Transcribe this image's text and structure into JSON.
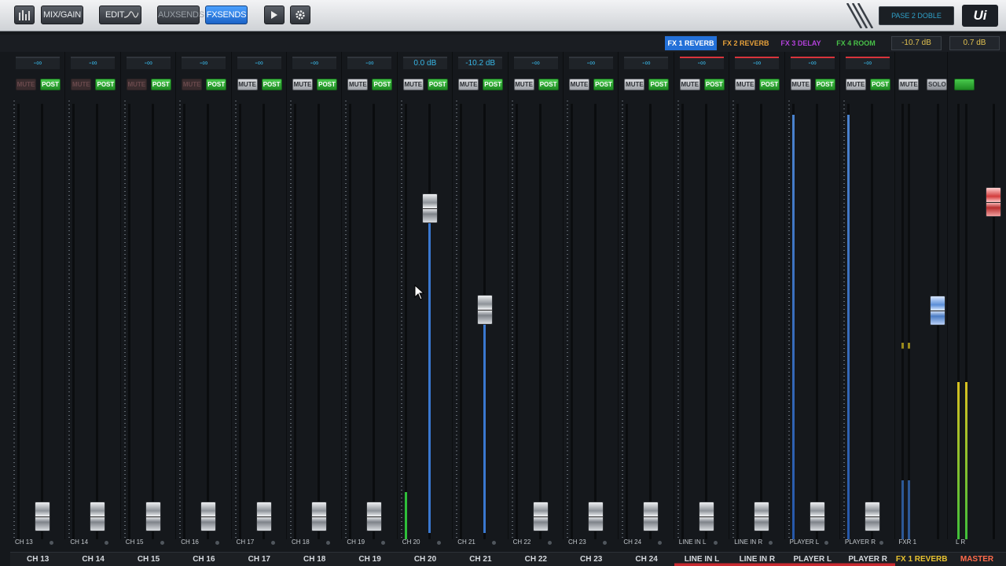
{
  "toolbar": {
    "mix_gain": "MIX/GAIN",
    "edit": "EDIT",
    "aux_sends": "AUXSENDS",
    "fx_sends": "FXSENDS",
    "preset": "PASE 2 DOBLE",
    "logo": "Ui"
  },
  "fx_tabs": [
    {
      "label": "FX 1 REVERB",
      "color": "#ffffff",
      "selected": true
    },
    {
      "label": "FX 2 REVERB",
      "color": "#e8a23a",
      "selected": false
    },
    {
      "label": "FX 3 DELAY",
      "color": "#b040d8",
      "selected": false
    },
    {
      "label": "FX 4 ROOM",
      "color": "#48c048",
      "selected": false
    }
  ],
  "fx_readout": "-10.7 dB",
  "master_readout": "0.7 dB",
  "channels": [
    {
      "short": "CH 13",
      "name": "CH 13",
      "level": "-∞",
      "mute_on": false,
      "send_db": null
    },
    {
      "short": "CH 14",
      "name": "CH 14",
      "level": "-∞",
      "mute_on": false,
      "send_db": null
    },
    {
      "short": "CH 15",
      "name": "CH 15",
      "level": "-∞",
      "mute_on": false,
      "send_db": null
    },
    {
      "short": "CH 16",
      "name": "CH 16",
      "level": "-∞",
      "mute_on": false,
      "send_db": null
    },
    {
      "short": "CH 17",
      "name": "CH 17",
      "level": "-∞",
      "mute_on": true,
      "send_db": null
    },
    {
      "short": "CH 18",
      "name": "CH 18",
      "level": "-∞",
      "mute_on": true,
      "send_db": null
    },
    {
      "short": "CH 19",
      "name": "CH 19",
      "level": "-∞",
      "mute_on": true,
      "send_db": null
    },
    {
      "short": "CH 20",
      "name": "CH 20",
      "level": "0.0 dB",
      "mute_on": true,
      "send_db": 0.0
    },
    {
      "short": "CH 21",
      "name": "CH 21",
      "level": "-10.2 dB",
      "mute_on": true,
      "send_db": -10.2
    },
    {
      "short": "CH 22",
      "name": "CH 22",
      "level": "-∞",
      "mute_on": true,
      "send_db": null
    },
    {
      "short": "CH 23",
      "name": "CH 23",
      "level": "-∞",
      "mute_on": true,
      "send_db": null
    },
    {
      "short": "CH 24",
      "name": "CH 24",
      "level": "-∞",
      "mute_on": true,
      "send_db": null
    },
    {
      "short": "LINE IN L",
      "name": "LINE IN L",
      "level": "-∞",
      "mute_on": true,
      "send_db": null,
      "red": true
    },
    {
      "short": "LINE IN R",
      "name": "LINE IN R",
      "level": "-∞",
      "mute_on": true,
      "send_db": null,
      "red": true
    },
    {
      "short": "PLAYER L",
      "name": "PLAYER L",
      "level": "-∞",
      "mute_on": true,
      "send_db": null,
      "red": true
    },
    {
      "short": "PLAYER R",
      "name": "PLAYER R",
      "level": "-∞",
      "mute_on": true,
      "send_db": null,
      "red": true
    }
  ],
  "fx_return": {
    "short": "FXR 1",
    "name": "FX 1 REVERB",
    "mute": "MUTE",
    "solo": "SOLO"
  },
  "master": {
    "short": "L R",
    "name": "MASTER"
  },
  "labels": {
    "mute": "MUTE",
    "post": "POST"
  }
}
